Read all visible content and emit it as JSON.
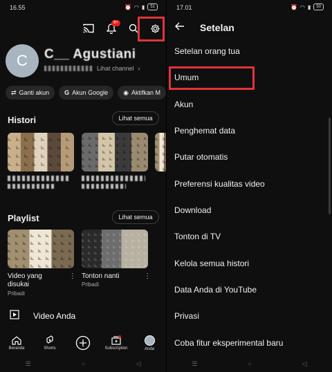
{
  "left": {
    "status": {
      "time": "16.55",
      "battery": "51"
    },
    "notifications_badge": "9+",
    "profile": {
      "avatar_letter": "C",
      "name": "C__ Agustiani",
      "view_channel": "Lihat channel"
    },
    "chips": [
      "Ganti akun",
      "Akun Google",
      "Aktifkan M"
    ],
    "history": {
      "title": "Histori",
      "see_all": "Lihat semua"
    },
    "playlist": {
      "title": "Playlist",
      "see_all": "Lihat semua",
      "items": [
        {
          "title": "Video yang disukai",
          "sub": "Pribadi"
        },
        {
          "title": "Tonton nanti",
          "sub": "Pribadi"
        }
      ]
    },
    "your_videos": "Video Anda",
    "bottom_nav": [
      "Beranda",
      "Shorts",
      "",
      "Subscription",
      "Anda"
    ],
    "colors": {
      "highlight": "#e0343a",
      "badge": "#e62117"
    }
  },
  "right": {
    "status": {
      "time": "17.01",
      "battery": "50"
    },
    "title": "Setelan",
    "items": [
      "Setelan orang tua",
      "Umum",
      "Akun",
      "Penghemat data",
      "Putar otomatis",
      "Preferensi kualitas video",
      "Download",
      "Tonton di TV",
      "Kelola semua histori",
      "Data Anda di YouTube",
      "Privasi",
      "Coba fitur eksperimental baru"
    ]
  }
}
